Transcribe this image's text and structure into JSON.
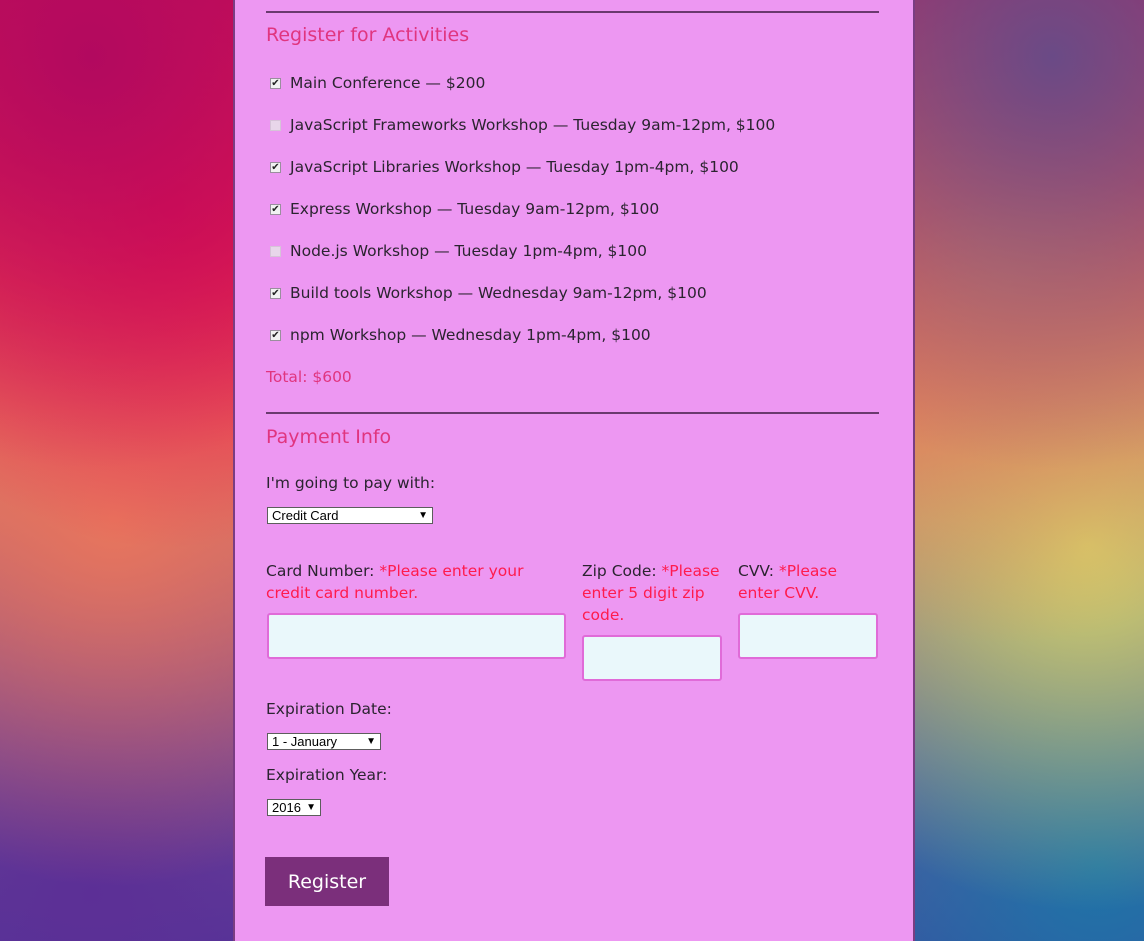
{
  "activities": {
    "title": "Register for Activities",
    "items": [
      {
        "label": "Main Conference — $200",
        "checked": true
      },
      {
        "label": "JavaScript Frameworks Workshop — Tuesday 9am-12pm, $100",
        "checked": false
      },
      {
        "label": "JavaScript Libraries Workshop — Tuesday 1pm-4pm, $100",
        "checked": true
      },
      {
        "label": "Express Workshop — Tuesday 9am-12pm, $100",
        "checked": true
      },
      {
        "label": "Node.js Workshop — Tuesday 1pm-4pm, $100",
        "checked": false
      },
      {
        "label": "Build tools Workshop — Wednesday 9am-12pm, $100",
        "checked": true
      },
      {
        "label": "npm Workshop — Wednesday 1pm-4pm, $100",
        "checked": true
      }
    ],
    "total": "Total: $600"
  },
  "payment": {
    "title": "Payment Info",
    "method_label": "I'm going to pay with:",
    "method_value": "Credit Card",
    "card_label": "Card Number:",
    "card_error": "*Please enter your credit card number.",
    "zip_label": "Zip Code:",
    "zip_error": "*Please enter 5 digit zip code.",
    "cvv_label": "CVV:",
    "cvv_error": "*Please enter CVV.",
    "exp_date_label": "Expiration Date:",
    "exp_month_value": "1 - January",
    "exp_year_label": "Expiration Year:",
    "exp_year_value": "2016"
  },
  "register_label": "Register",
  "colors": {
    "panel": "#ed97f2",
    "accent": "#e0357f",
    "error": "#ff1b4d",
    "button": "#7b2f7b"
  }
}
